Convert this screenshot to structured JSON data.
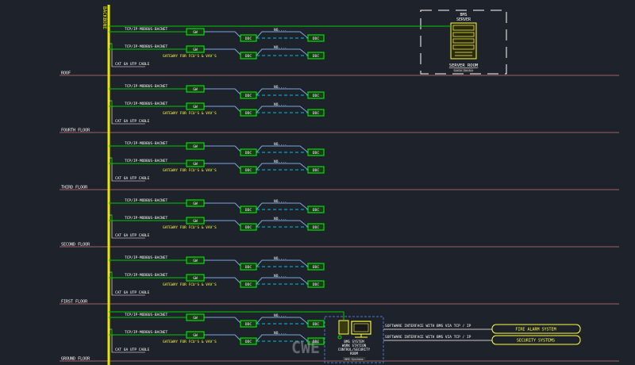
{
  "backbone_label": "BACKBONE",
  "floors": [
    {
      "name": "ROOF",
      "tcp_labels": [
        "TCP/IP-MODBUS-BACNET",
        "TCP/IP-MODBUS-BACNET"
      ],
      "gateway_label": "GATEWAY FOR FCU'S & VAV'S",
      "cable_label": "CAT 6A UTP CABLE"
    },
    {
      "name": "FOURTH FLOOR",
      "tcp_labels": [
        "TCP/IP-MODBUS-BACNET",
        "TCP/IP-MODBUS-BACNET"
      ],
      "gateway_label": "GATEWAY FOR FCU'S & VAV'S",
      "cable_label": "CAT 6A UTP CABLE"
    },
    {
      "name": "THIRD FLOOR",
      "tcp_labels": [
        "TCP/IP-MODBUS-BACNET",
        "TCP/IP-MODBUS-BACNET"
      ],
      "gateway_label": "GATEWAY FOR FCU'S & VAV'S",
      "cable_label": "CAT 6A UTP CABLE"
    },
    {
      "name": "SECOND FLOOR",
      "tcp_labels": [
        "TCP/IP-MODBUS-BACNET",
        "TCP/IP-MODBUS-BACNET"
      ],
      "gateway_label": "GATEWAY FOR FCU'S & VAV'S",
      "cable_label": "CAT 6A UTP CABLE"
    },
    {
      "name": "FIRST FLOOR",
      "tcp_labels": [
        "TCP/IP-MODBUS-BACNET",
        "TCP/IP-MODBUS-BACNET"
      ],
      "gateway_label": "GATEWAY FOR FCU'S & VAV'S",
      "cable_label": "CAT 6A UTP CABLE"
    },
    {
      "name": "GROUND FLOOR",
      "tcp_labels": [
        "TCP/IP-MODBUS-BACNET",
        "TCP/IP-MODBUS-BACNET"
      ],
      "gateway_label": "GATEWAY FOR FCU'S & VAV'S",
      "cable_label": "CAT 6A UTP CABLE"
    }
  ],
  "gw_label": "GW",
  "ddc_label": "DDC",
  "no_label": "NO....",
  "server": {
    "title_line1": "BMS",
    "title_line2": "SERVER",
    "room_label": "SERVER ROOM",
    "room_tag": "Scale Sector"
  },
  "workstation": {
    "lines": [
      "BMS SYSTEM",
      "WORK STATION",
      "CONTROL/SECURITY",
      "ROOM"
    ],
    "tag": "BMS Systems"
  },
  "interfaces": [
    {
      "label": "SOFTWARE INTERFACE WITH BMS VIA TCP / IP",
      "system": "FIRE ALARM SYSTEM"
    },
    {
      "label": "SOFTWARE INTERFACE WITH BMS VIA TCP / IP",
      "system": "SECURITY SYSTEMS"
    }
  ],
  "watermark": "CWE",
  "colors": {
    "background": "#1e222a",
    "backbone": "#e8e800",
    "green_line": "#00c800",
    "device_outline": "#00e000",
    "device_fill": "#1a3a1a",
    "blue_line": "#7aa6e0",
    "cyan_dashed": "#00c0e0",
    "floor_line": "#c87a7a",
    "text_white": "#ffffff",
    "text_yellow": "#ffff40",
    "interface_box": "#ffff40"
  }
}
